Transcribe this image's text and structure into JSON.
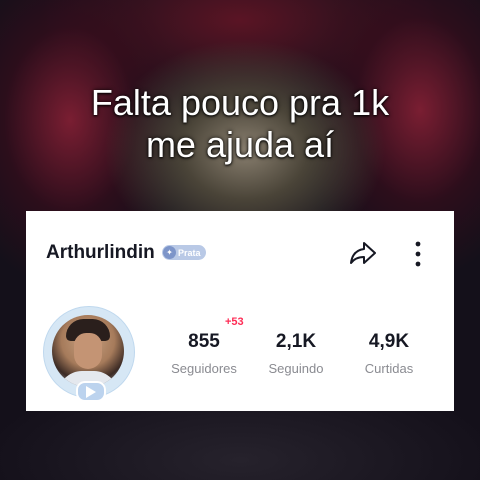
{
  "caption": {
    "line1": "Falta pouco pra 1k",
    "line2": "me ajuda aí"
  },
  "profile": {
    "username": "Arthurlindin",
    "badge_label": "Prata",
    "followers_delta": "+53"
  },
  "stats": [
    {
      "value": "855",
      "label": "Seguidores"
    },
    {
      "value": "2,1K",
      "label": "Seguindo"
    },
    {
      "value": "4,9K",
      "label": "Curtidas"
    }
  ],
  "icons": {
    "share": "share-icon",
    "more": "more-vertical-icon",
    "badge": "medal-icon",
    "live": "play-icon"
  },
  "colors": {
    "delta": "#fe2c55",
    "badge": "#b9c9e6",
    "text_primary": "#161823",
    "text_secondary": "#8a8b91"
  }
}
